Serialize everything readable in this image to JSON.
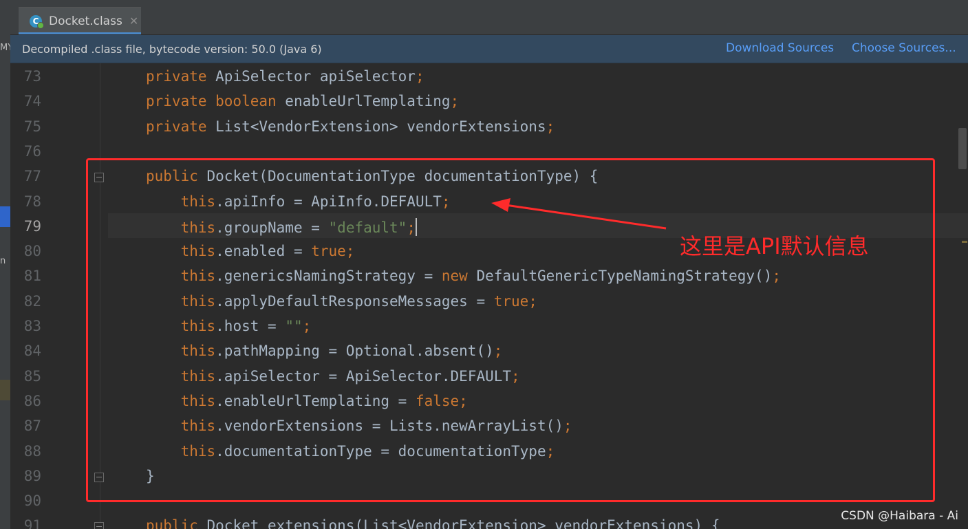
{
  "tab": {
    "label": "Docket.class",
    "icon": "C"
  },
  "left_strip": {
    "mark_top": "MY",
    "mark_mid": "n"
  },
  "banner": {
    "message": "Decompiled .class file, bytecode version: 50.0 (Java 6)",
    "download_sources": "Download Sources",
    "choose_sources": "Choose Sources..."
  },
  "editor": {
    "current_line": 79,
    "lines": [
      {
        "n": "73",
        "tokens": [
          [
            "kw",
            "private "
          ],
          [
            "t",
            "ApiSelector apiSelector"
          ],
          [
            "kw",
            ";"
          ]
        ]
      },
      {
        "n": "74",
        "tokens": [
          [
            "kw",
            "private boolean "
          ],
          [
            "t",
            "enableUrlTemplating"
          ],
          [
            "kw",
            ";"
          ]
        ]
      },
      {
        "n": "75",
        "tokens": [
          [
            "kw",
            "private "
          ],
          [
            "t",
            "List<VendorExtension> vendorExtensions"
          ],
          [
            "kw",
            ";"
          ]
        ]
      },
      {
        "n": "76",
        "tokens": []
      },
      {
        "n": "77",
        "tokens": [
          [
            "kw",
            "public "
          ],
          [
            "t",
            "Docket(DocumentationType documentationType) {"
          ]
        ]
      },
      {
        "n": "78",
        "tokens": [
          [
            "t",
            "    "
          ],
          [
            "kw",
            "this"
          ],
          [
            "t",
            ".apiInfo = ApiInfo."
          ],
          [
            "t",
            "DEFAULT"
          ],
          [
            "kw",
            ";"
          ]
        ]
      },
      {
        "n": "79",
        "tokens": [
          [
            "t",
            "    "
          ],
          [
            "kw",
            "this"
          ],
          [
            "t",
            ".groupName = "
          ],
          [
            "str",
            "\"default\""
          ],
          [
            "kw",
            ";"
          ],
          [
            "caret",
            ""
          ]
        ]
      },
      {
        "n": "80",
        "tokens": [
          [
            "t",
            "    "
          ],
          [
            "kw",
            "this"
          ],
          [
            "t",
            ".enabled = "
          ],
          [
            "kw",
            "true;"
          ]
        ]
      },
      {
        "n": "81",
        "tokens": [
          [
            "t",
            "    "
          ],
          [
            "kw",
            "this"
          ],
          [
            "t",
            ".genericsNamingStrategy = "
          ],
          [
            "kw",
            "new "
          ],
          [
            "t",
            "DefaultGenericTypeNamingStrategy()"
          ],
          [
            "kw",
            ";"
          ]
        ]
      },
      {
        "n": "82",
        "tokens": [
          [
            "t",
            "    "
          ],
          [
            "kw",
            "this"
          ],
          [
            "t",
            ".applyDefaultResponseMessages = "
          ],
          [
            "kw",
            "true;"
          ]
        ]
      },
      {
        "n": "83",
        "tokens": [
          [
            "t",
            "    "
          ],
          [
            "kw",
            "this"
          ],
          [
            "t",
            ".host = "
          ],
          [
            "str",
            "\"\""
          ],
          [
            "kw",
            ";"
          ]
        ]
      },
      {
        "n": "84",
        "tokens": [
          [
            "t",
            "    "
          ],
          [
            "kw",
            "this"
          ],
          [
            "t",
            ".pathMapping = Optional.absent()"
          ],
          [
            "kw",
            ";"
          ]
        ]
      },
      {
        "n": "85",
        "tokens": [
          [
            "t",
            "    "
          ],
          [
            "kw",
            "this"
          ],
          [
            "t",
            ".apiSelector = ApiSelector."
          ],
          [
            "t",
            "DEFAULT"
          ],
          [
            "kw",
            ";"
          ]
        ]
      },
      {
        "n": "86",
        "tokens": [
          [
            "t",
            "    "
          ],
          [
            "kw",
            "this"
          ],
          [
            "t",
            ".enableUrlTemplating = "
          ],
          [
            "kw",
            "false;"
          ]
        ]
      },
      {
        "n": "87",
        "tokens": [
          [
            "t",
            "    "
          ],
          [
            "kw",
            "this"
          ],
          [
            "t",
            ".vendorExtensions = Lists.newArrayList()"
          ],
          [
            "kw",
            ";"
          ]
        ]
      },
      {
        "n": "88",
        "tokens": [
          [
            "t",
            "    "
          ],
          [
            "kw",
            "this"
          ],
          [
            "t",
            ".documentationType = documentationType"
          ],
          [
            "kw",
            ";"
          ]
        ]
      },
      {
        "n": "89",
        "tokens": [
          [
            "t",
            "}"
          ]
        ]
      },
      {
        "n": "90",
        "tokens": []
      },
      {
        "n": "91",
        "tokens": [
          [
            "kw",
            "public "
          ],
          [
            "t",
            "Docket extensions(List<VendorExtension> vendorExtensions) {"
          ]
        ]
      }
    ]
  },
  "annotation": {
    "text": "这里是API默认信息",
    "color": "#ff2b2b"
  },
  "watermark": "CSDN @Haibara - Ai"
}
